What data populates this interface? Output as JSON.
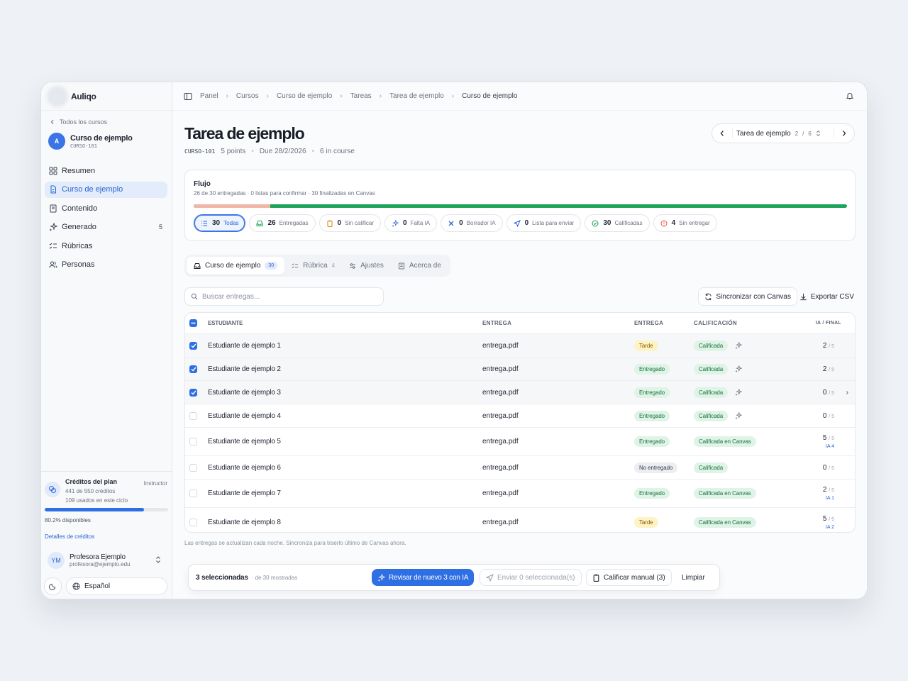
{
  "app": {
    "name": "Auliqo"
  },
  "sidebar": {
    "back_label": "Todos los cursos",
    "course": {
      "avatar": "A",
      "title": "Curso de ejemplo",
      "code": "CURSO-101"
    },
    "items": [
      {
        "label": "Resumen",
        "icon": "grid-icon"
      },
      {
        "label": "Curso de ejemplo",
        "icon": "document-icon",
        "active": true
      },
      {
        "label": "Contenido",
        "icon": "book-icon"
      },
      {
        "label": "Generado",
        "icon": "sparkles-icon",
        "count": "5"
      },
      {
        "label": "Rúbricas",
        "icon": "list-check-icon"
      },
      {
        "label": "Personas",
        "icon": "users-icon"
      }
    ],
    "credits": {
      "title": "Créditos del plan",
      "role": "Instructor",
      "used_of": "441 de 550 créditos",
      "cycle": "109 usados en este ciclo",
      "fraction_available": 0.802,
      "available_label": "80.2% disponibles",
      "details_link": "Detalles de créditos"
    },
    "user": {
      "initials": "YM",
      "name": "Profesora Ejemplo",
      "email": "profesora@ejemplo.edu"
    },
    "language": "Español"
  },
  "breadcrumb": [
    "Panel",
    "Cursos",
    "Curso de ejemplo",
    "Tareas",
    "Tarea de ejemplo",
    "Curso de ejemplo"
  ],
  "assignment": {
    "title": "Tarea de ejemplo",
    "code": "CURSO-101",
    "points": "5 points",
    "due": "Due 28/2/2026",
    "course_count": "6 in course"
  },
  "pager": {
    "label": "Tarea de ejemplo",
    "current": "2",
    "sep": "/",
    "total": "6"
  },
  "flow": {
    "title": "Flujo",
    "subtitle": "26 de 30 entregadas · 0 listas para confirmar · 30 finalizadas en Canvas",
    "red_fraction": 0.117,
    "chips": [
      {
        "count": "30",
        "label": "Todas",
        "icon": "list-icon",
        "active": true
      },
      {
        "count": "26",
        "label": "Entregadas",
        "icon": "inbox-icon"
      },
      {
        "count": "0",
        "label": "Sin calificar",
        "icon": "clipboard-icon"
      },
      {
        "count": "0",
        "label": "Falta IA",
        "icon": "sparkles-icon"
      },
      {
        "count": "0",
        "label": "Borrador IA",
        "icon": "cross-sparkle-icon"
      },
      {
        "count": "0",
        "label": "Lista para enviar",
        "icon": "send-icon"
      },
      {
        "count": "30",
        "label": "Calificadas",
        "icon": "check-circle-icon"
      },
      {
        "count": "4",
        "label": "Sin entregar",
        "icon": "alert-circle-icon"
      }
    ]
  },
  "tabs": [
    {
      "label": "Curso de ejemplo",
      "badge": "30",
      "active": true
    },
    {
      "label": "Rúbrica",
      "count": "4"
    },
    {
      "label": "Ajustes"
    },
    {
      "label": "Acerca de"
    }
  ],
  "search": {
    "placeholder": "Buscar entregas..."
  },
  "actions": {
    "sync": "Sincronizar con Canvas",
    "export": "Exportar CSV"
  },
  "table": {
    "headers": [
      "ESTUDIANTE",
      "ENTREGA",
      "ENTREGA",
      "CALIFICACIÓN",
      "IA / FINAL"
    ],
    "rows": [
      {
        "name": "Estudiante de ejemplo 1",
        "file": "entrega.pdf",
        "status": "Tarde",
        "grade": "Calificada",
        "score": "2",
        "max": "/ 5",
        "ia": "",
        "checked": true
      },
      {
        "name": "Estudiante de ejemplo 2",
        "file": "entrega.pdf",
        "status": "Entregado",
        "grade": "Calificada",
        "score": "2",
        "max": "/ 5",
        "ia": "",
        "checked": true
      },
      {
        "name": "Estudiante de ejemplo 3",
        "file": "entrega.pdf",
        "status": "Entregado",
        "grade": "Calificada",
        "score": "0",
        "max": "/ 5",
        "ia": "",
        "checked": true
      },
      {
        "name": "Estudiante de ejemplo 4",
        "file": "entrega.pdf",
        "status": "Entregado",
        "grade": "Calificada",
        "score": "0",
        "max": "/ 5",
        "ia": "",
        "checked": false
      },
      {
        "name": "Estudiante de ejemplo 5",
        "file": "entrega.pdf",
        "status": "Entregado",
        "grade": "Calificada en Canvas",
        "score": "5",
        "max": "/ 5",
        "ia": "IA 4",
        "checked": false
      },
      {
        "name": "Estudiante de ejemplo 6",
        "file": "entrega.pdf",
        "status": "No entregado",
        "grade": "Calificada",
        "score": "0",
        "max": "/ 5",
        "ia": "",
        "checked": false
      },
      {
        "name": "Estudiante de ejemplo 7",
        "file": "entrega.pdf",
        "status": "Entregado",
        "grade": "Calificada en Canvas",
        "score": "2",
        "max": "/ 5",
        "ia": "IA 1",
        "checked": false
      },
      {
        "name": "Estudiante de ejemplo 8",
        "file": "entrega.pdf",
        "status": "Tarde",
        "grade": "Calificada en Canvas",
        "score": "5",
        "max": "/ 5",
        "ia": "IA 2",
        "checked": false
      }
    ]
  },
  "note": "Las entregas se actualizan cada noche. Sincroniza para traerlo último de Canvas ahora.",
  "action_bar": {
    "selected": "3 seleccionadas",
    "shown": "· de 30 mostradas",
    "ai_review": "Revisar de nuevo 3 con IA",
    "send": "Enviar 0 seleccionada(s)",
    "manual": "Calificar manual (3)",
    "clear": "Limpiar"
  },
  "colors": {
    "accent": "#2f6fe4",
    "success": "#1fa35a",
    "late": "#fdf3c4"
  }
}
